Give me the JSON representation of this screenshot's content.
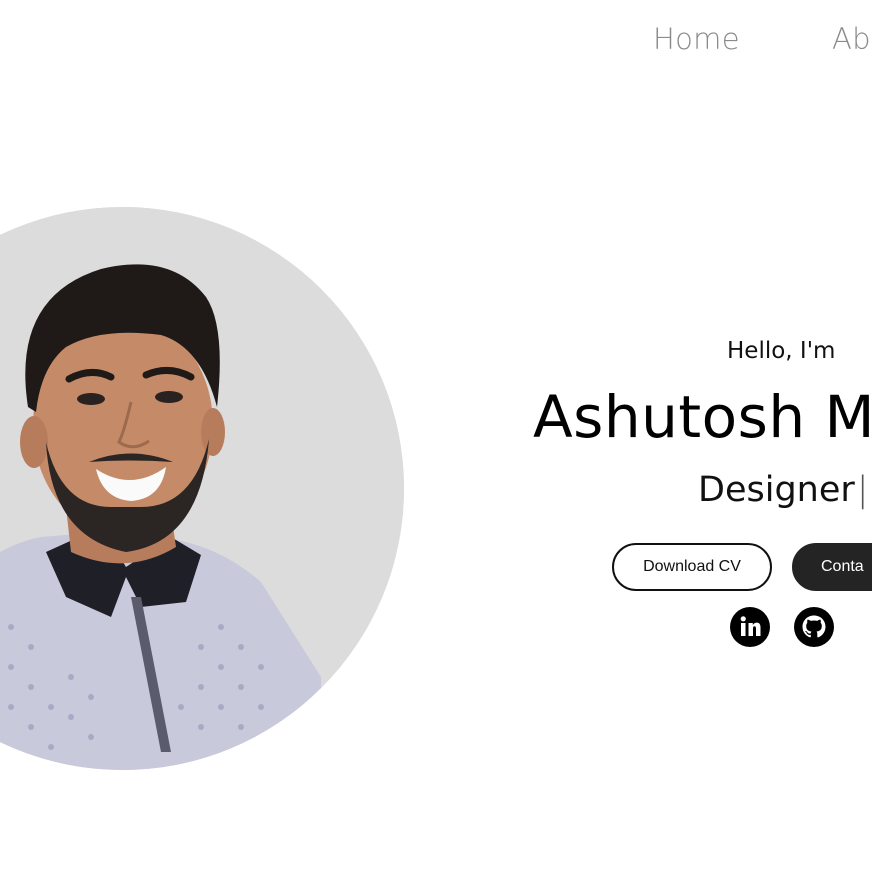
{
  "nav": {
    "items": [
      {
        "label": "Home"
      },
      {
        "label": "Ab"
      }
    ]
  },
  "profile": {
    "photo_alt": "profile-photo"
  },
  "hero": {
    "greeting": "Hello, I'm",
    "name": "Ashutosh M",
    "role": "Designer",
    "cursor": "|"
  },
  "buttons": {
    "download_cv": "Download CV",
    "contact": "Conta"
  },
  "social": [
    {
      "icon": "linkedin-icon"
    },
    {
      "icon": "github-icon"
    }
  ],
  "colors": {
    "background": "#ffffff",
    "nav_text": "#8a8a8a",
    "photo_bg": "#dcdcdc",
    "button_dark": "#242424"
  }
}
